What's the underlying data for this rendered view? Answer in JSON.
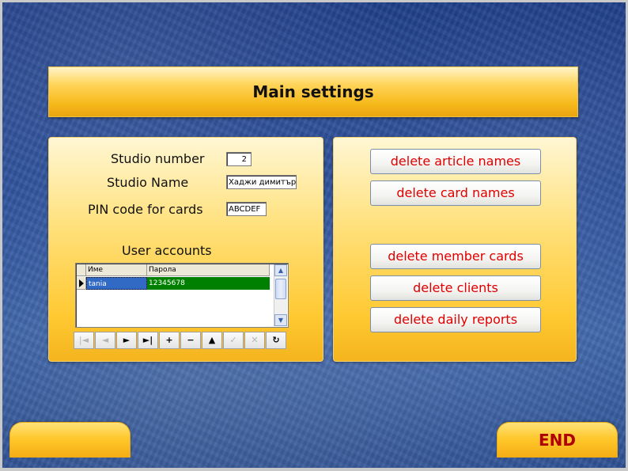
{
  "title": "Main settings",
  "settings": {
    "studio_number_label": "Studio number",
    "studio_number_value": "2",
    "studio_name_label": "Studio Name",
    "studio_name_value": "Хаджи димитър",
    "pin_label": "PIN code for cards",
    "pin_value": "ABCDEF"
  },
  "accounts": {
    "label": "User accounts",
    "columns": [
      "Име",
      "Парола"
    ],
    "rows": [
      {
        "name": "tania",
        "password": "12345678"
      }
    ]
  },
  "navigator": {
    "buttons": [
      {
        "name": "first-record-button",
        "glyph": "|◄",
        "enabled": false
      },
      {
        "name": "prior-record-button",
        "glyph": "◄",
        "enabled": false
      },
      {
        "name": "next-record-button",
        "glyph": "►",
        "enabled": true
      },
      {
        "name": "last-record-button",
        "glyph": "►|",
        "enabled": true
      },
      {
        "name": "insert-record-button",
        "glyph": "+",
        "enabled": true
      },
      {
        "name": "delete-record-button",
        "glyph": "−",
        "enabled": true
      },
      {
        "name": "edit-record-button",
        "glyph": "▲",
        "enabled": true
      },
      {
        "name": "post-record-button",
        "glyph": "✓",
        "enabled": false
      },
      {
        "name": "cancel-record-button",
        "glyph": "✕",
        "enabled": false
      },
      {
        "name": "refresh-record-button",
        "glyph": "↻",
        "enabled": true
      }
    ]
  },
  "actions": {
    "delete_article_names": "delete article names",
    "delete_card_names": "delete card names",
    "delete_member_cards": "delete member cards",
    "delete_clients": "delete clients",
    "delete_daily_reports": "delete daily reports"
  },
  "footer": {
    "left_label": "",
    "end_label": "END"
  },
  "colors": {
    "accent_orange": "#ffc82c",
    "button_text_red": "#e00000",
    "end_text_red": "#b00000",
    "selected_row_blue": "#316ac5",
    "selected_row_green": "#008000"
  }
}
